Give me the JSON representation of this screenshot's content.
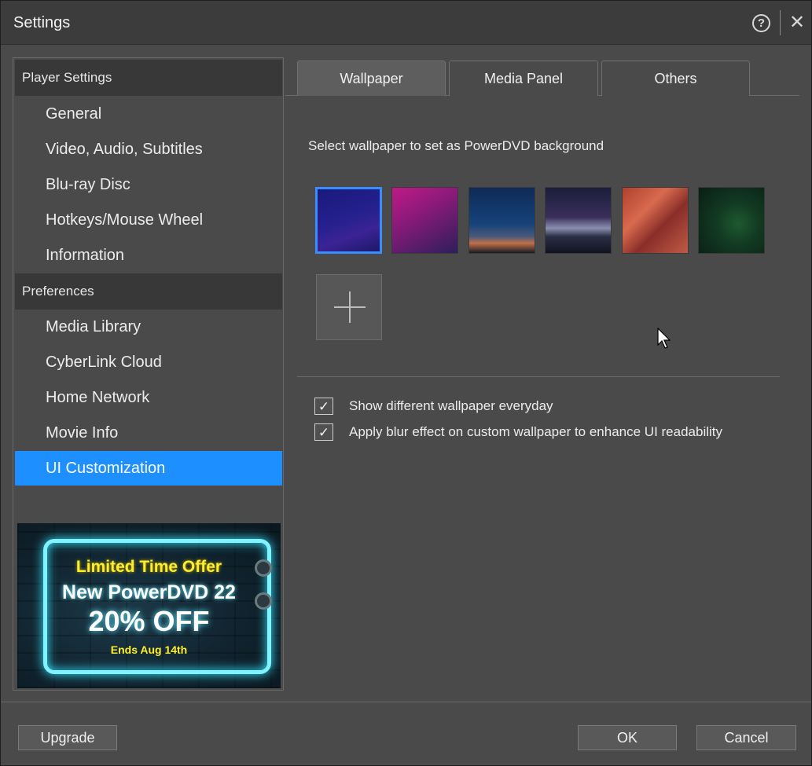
{
  "window": {
    "title": "Settings",
    "help_icon": "help-icon",
    "help_glyph": "?",
    "close_icon": "close-icon",
    "close_glyph": "✕"
  },
  "sidebar": {
    "sections": [
      {
        "header": "Player Settings",
        "items": [
          "General",
          "Video, Audio, Subtitles",
          "Blu-ray Disc",
          "Hotkeys/Mouse Wheel",
          "Information"
        ]
      },
      {
        "header": "Preferences",
        "items": [
          "Media Library",
          "CyberLink Cloud",
          "Home Network",
          "Movie Info",
          "UI Customization"
        ]
      }
    ],
    "active_item": "UI Customization",
    "accent_color": "#1e8fff"
  },
  "promo": {
    "line1": "Limited Time Offer",
    "line2": "New PowerDVD 22",
    "line3": "20% OFF",
    "line4": "Ends Aug 14th"
  },
  "tabs": [
    {
      "label": "Wallpaper",
      "active": true
    },
    {
      "label": "Media Panel",
      "active": false
    },
    {
      "label": "Others",
      "active": false
    }
  ],
  "wallpaper": {
    "instruction": "Select wallpaper to set as PowerDVD background",
    "thumbnails": [
      "wallpaper-1",
      "wallpaper-2",
      "wallpaper-3",
      "wallpaper-4",
      "wallpaper-5",
      "wallpaper-6"
    ],
    "selected_index": 0,
    "add_icon": "plus-icon",
    "options": [
      {
        "label": "Show different wallpaper everyday",
        "checked": true
      },
      {
        "label": "Apply blur effect on custom wallpaper to enhance UI readability",
        "checked": true
      }
    ]
  },
  "footer": {
    "upgrade_label": "Upgrade",
    "ok_label": "OK",
    "cancel_label": "Cancel"
  }
}
